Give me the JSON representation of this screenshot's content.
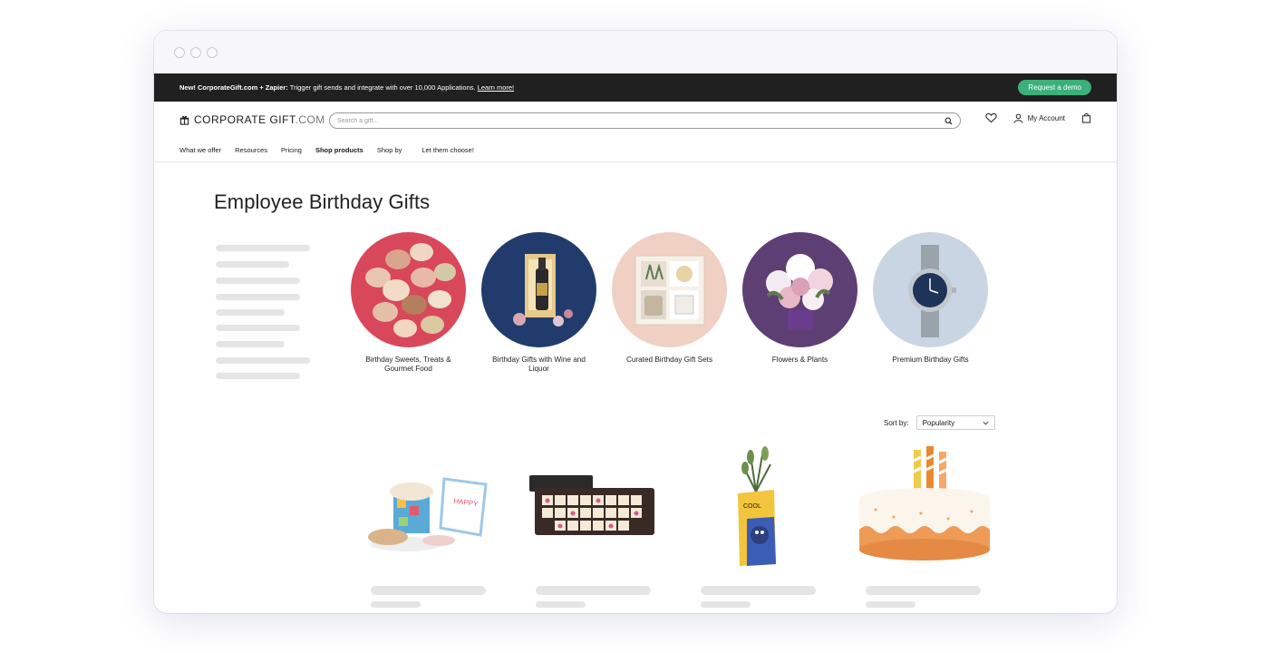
{
  "promo": {
    "lead": "New! CorporateGift.com + Zapier:",
    "text": " Trigger gift sends and integrate with over 10,000 Applications. ",
    "link": "Learn more!",
    "demo_button": "Request a demo"
  },
  "header": {
    "logo_main": "CORPORATE GIFT",
    "logo_suffix": ".COM",
    "search_placeholder": "Search a gift...",
    "account_label": "My Account"
  },
  "nav": {
    "items": [
      "What we offer",
      "Resources",
      "Pricing",
      "Shop products",
      "Shop by",
      "Let them choose!"
    ],
    "active": "Shop products"
  },
  "page": {
    "title": "Employee Birthday Gifts"
  },
  "categories": [
    {
      "label": "Birthday Sweets, Treats & Gourmet Food",
      "color": "#d9475a"
    },
    {
      "label": "Birthday Gifts with Wine and Liquor",
      "color": "#213c6c"
    },
    {
      "label": "Curated Birthday Gift Sets",
      "color": "#efd0c3"
    },
    {
      "label": "Flowers & Plants",
      "color": "#5e3f73"
    },
    {
      "label": "Premium Birthday Gifts",
      "color": "#c9d5e2"
    }
  ],
  "sort": {
    "label": "Sort by:",
    "value": "Popularity"
  },
  "products": [
    {
      "name": "birthday-sweets-gift-box"
    },
    {
      "name": "happy-birthday-chocolate-letters"
    },
    {
      "name": "cool-plant-gift"
    },
    {
      "name": "birthday-cake-candles"
    }
  ],
  "colors": {
    "accent_green": "#3bb07a",
    "promo_bar": "#202020"
  }
}
